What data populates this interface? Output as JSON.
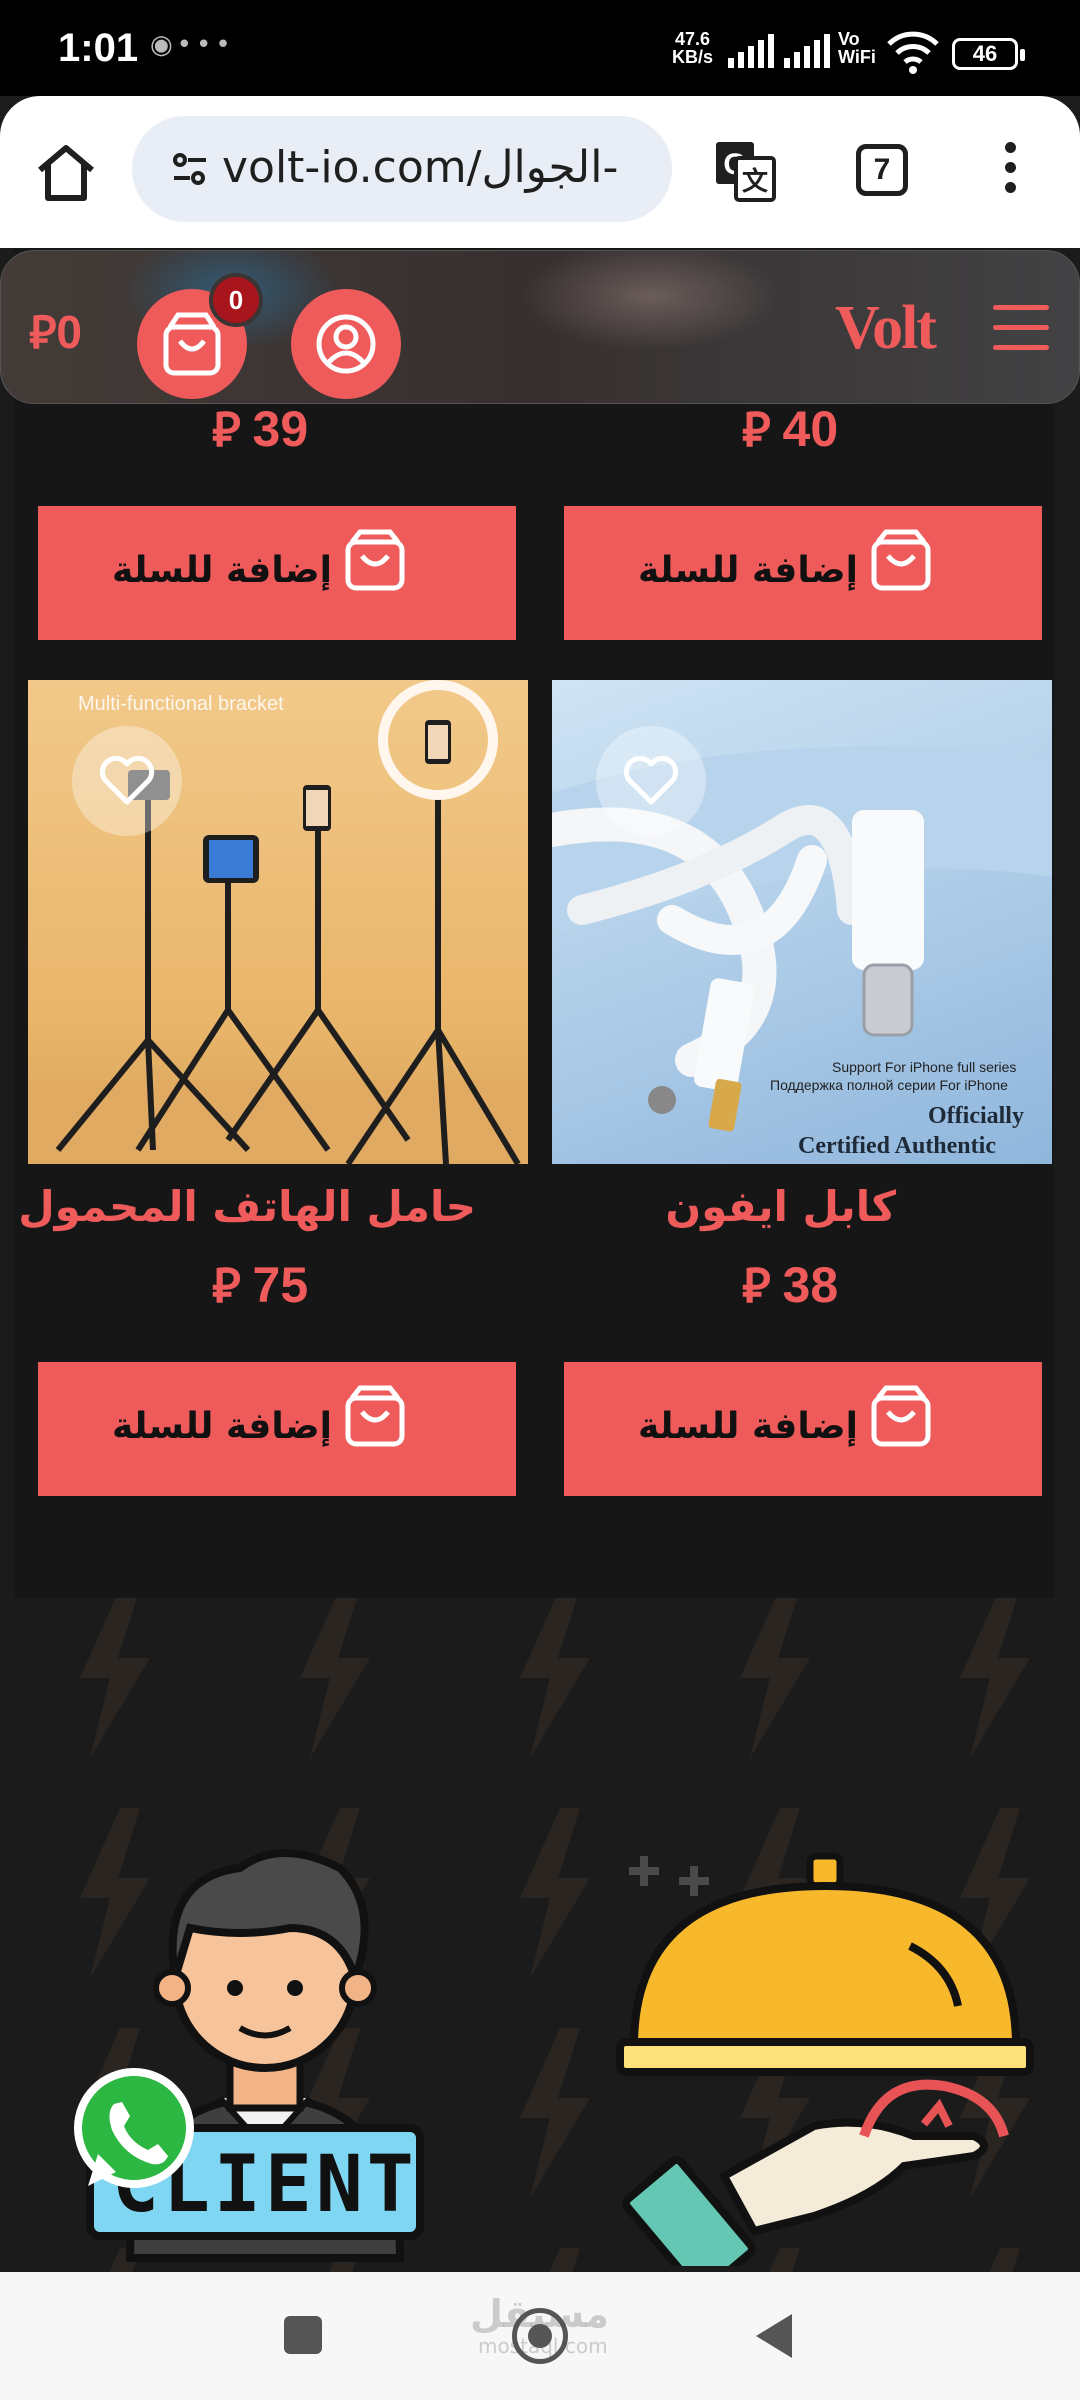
{
  "status_bar": {
    "time": "1:01",
    "net_speed_value": "47.6",
    "net_speed_unit": "KB/s",
    "vo": "Vo",
    "wifi_label": "WiFi",
    "battery": "46"
  },
  "browser": {
    "url": "volt-io.com/الجوال-",
    "tab_count": "7"
  },
  "header": {
    "cart_total": "0",
    "cart_count": "0",
    "logo": "Volt"
  },
  "currency_symbol": "⃁",
  "products_top": [
    {
      "price": "39",
      "add_label": "إضافة للسلة"
    },
    {
      "price": "40",
      "add_label": "إضافة للسلة"
    }
  ],
  "products": [
    {
      "name": "حامل الهاتف المحمول",
      "price": "75",
      "add_label": "إضافة للسلة",
      "image_text": "Multi-functional bracket"
    },
    {
      "name": "كابل ايفون",
      "price": "38",
      "add_label": "إضافة للسلة",
      "image_text_1": "Support For iPhone full series",
      "image_text_2": "Поддержка полной серии For iPhone",
      "image_text_3": "Officially",
      "image_text_4": "Certified Authentic"
    }
  ],
  "banner": {
    "client_label": "CLIENT"
  },
  "watermark": {
    "text": "مستقل",
    "sub": "mostaql.com"
  },
  "colors": {
    "accent": "#ef5b5b",
    "badge": "#a8151d",
    "page_bg": "#1b1b1b"
  }
}
